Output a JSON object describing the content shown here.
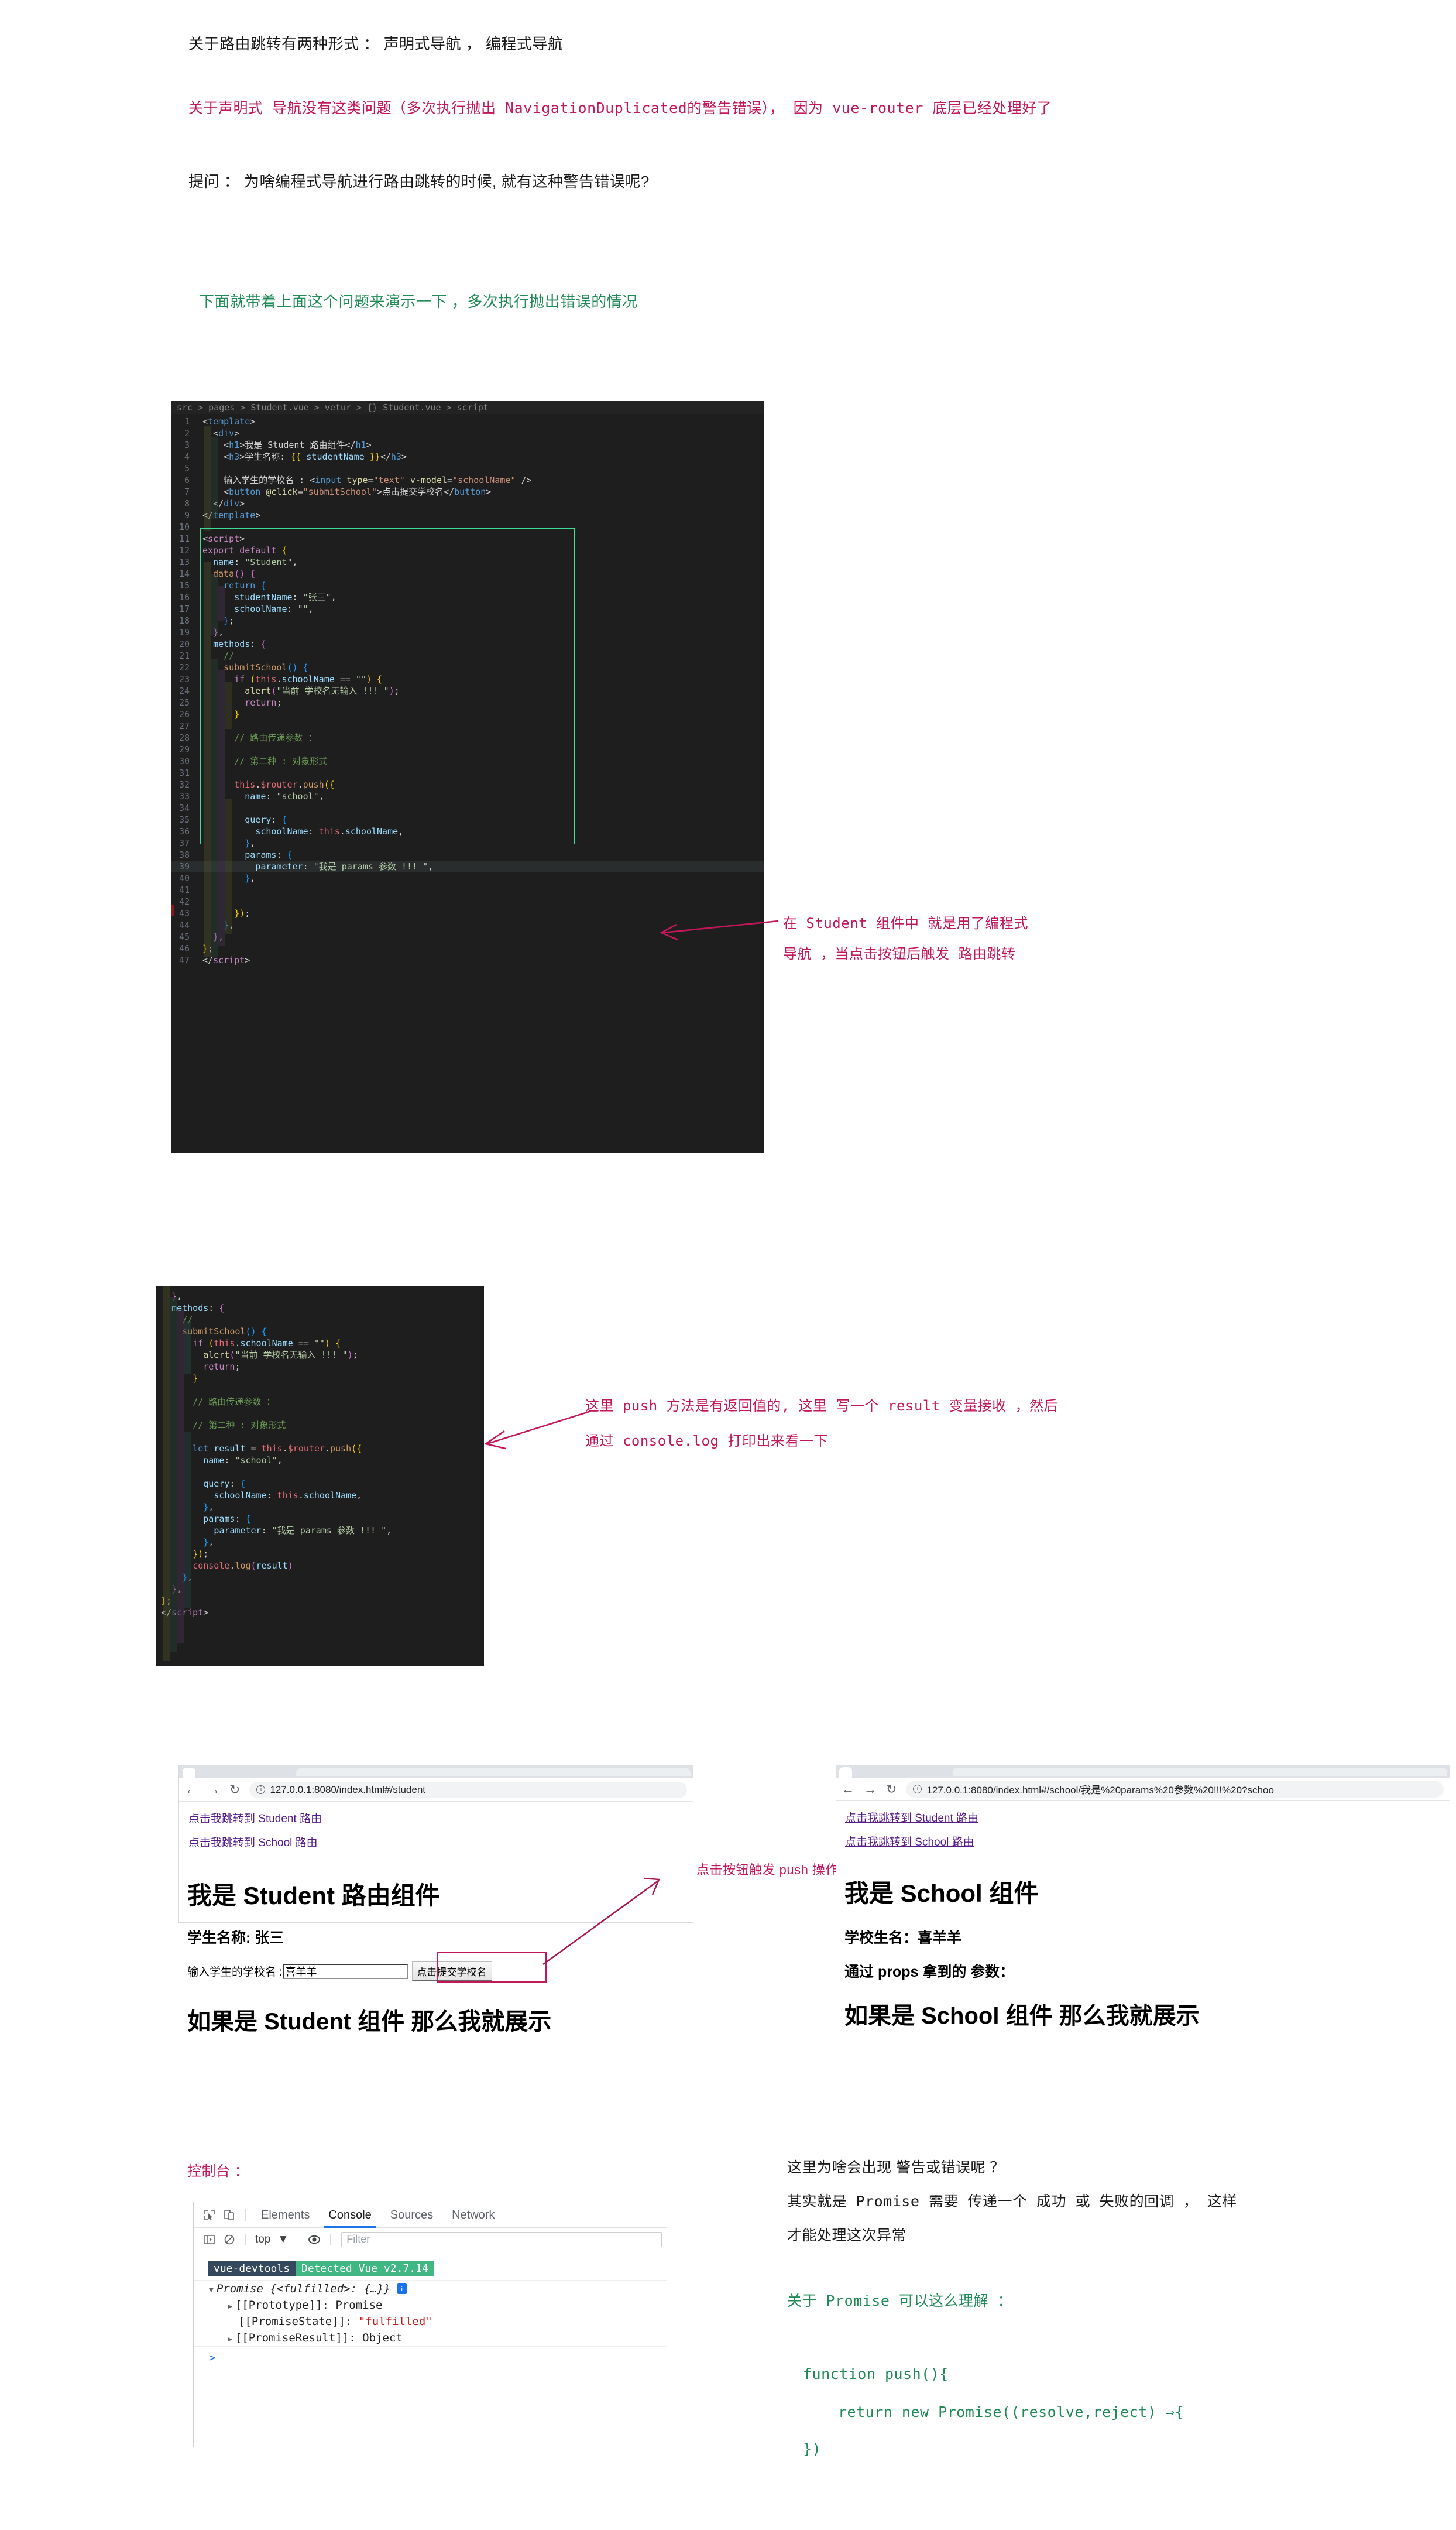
{
  "notes": {
    "intro": "关于路由跳转有两种形式 ：  声明式导航 ，  编程式导航",
    "declarative_red": "关于声明式 导航没有这类问题（多次执行抛出 NavigationDuplicated的警告错误）， 因为 vue-router 底层已经处理好了",
    "question": "提问 ：  为啥编程式导航进行路由跳转的时候, 就有这种警告错误呢?",
    "demo_green": "下面就带着上面这个问题来演示一下 ，多次执行抛出错误的情况",
    "anno1_line1": "在 Student 组件中 就是用了编程式",
    "anno1_line2": "导航 ，当点击按钮后触发 路由跳转",
    "anno2_line1": "这里 push 方法是有返回值的, 这里 写一个 result 变量接收 ，然后",
    "anno2_line2": "通过 console.log 打印出来看一下",
    "anno_button": "点击按钮触发 push 操作",
    "console_label": "控制台 ：",
    "why_warning": "这里为啥会出现 警告或错误呢 ？",
    "promise_explain": "其实就是 Promise 需要 传递一个 成功 或 失败的回调 ， 这样",
    "promise_explain2": "才能处理这次异常",
    "about_promise": "关于 Promise 可以这么理解 ：",
    "promise_code_1": "function push(){",
    "promise_code_2": "return new Promise((resolve,reject) ⇒{",
    "promise_code_3": "})"
  },
  "code1": {
    "breadcrumb": "src > pages > Student.vue > vetur > {} Student.vue > script",
    "lines": [
      {
        "n": "1",
        "html": "<span class='t-punc'>&lt;</span><span class='t-tag'>template</span><span class='t-punc'>&gt;</span>"
      },
      {
        "n": "2",
        "html": "  <span class='t-punc'>&lt;</span><span class='t-tag'>div</span><span class='t-punc'>&gt;</span>"
      },
      {
        "n": "3",
        "html": "    <span class='t-punc'>&lt;</span><span class='t-tag'>h1</span><span class='t-punc'>&gt;</span><span class='t-plain'>我是 Student 路由组件</span><span class='t-punc'>&lt;/</span><span class='t-tag'>h1</span><span class='t-punc'>&gt;</span>"
      },
      {
        "n": "4",
        "html": "    <span class='t-punc'>&lt;</span><span class='t-tag'>h3</span><span class='t-punc'>&gt;</span><span class='t-plain'>学生名称: </span><span class='t-brace1'>{{</span><span class='t-attr'> studentName </span><span class='t-brace1'>}}</span><span class='t-punc'>&lt;/</span><span class='t-tag'>h3</span><span class='t-punc'>&gt;</span>"
      },
      {
        "n": "5",
        "html": ""
      },
      {
        "n": "6",
        "html": "    <span class='t-plain'>输入学生的学校名 : </span><span class='t-punc'>&lt;</span><span class='t-tag'>input</span> <span class='t-fn'>type</span><span class='t-punc'>=</span><span class='t-str'>\"text\"</span> <span class='t-fn'>v-model</span><span class='t-punc'>=</span><span class='t-str'>\"schoolName\"</span> <span class='t-punc'>/&gt;</span>"
      },
      {
        "n": "7",
        "html": "    <span class='t-punc'>&lt;</span><span class='t-tag'>button</span> <span class='t-fn'>@click</span><span class='t-punc'>=</span><span class='t-str'>\"submitSchool\"</span><span class='t-punc'>&gt;</span><span class='t-plain'>点击提交学校名</span><span class='t-punc'>&lt;/</span><span class='t-tag'>button</span><span class='t-punc'>&gt;</span>"
      },
      {
        "n": "8",
        "html": "  <span class='t-punc'>&lt;/</span><span class='t-tag'>div</span><span class='t-punc'>&gt;</span>"
      },
      {
        "n": "9",
        "html": "<span class='t-punc'>&lt;/</span><span class='t-tag'>template</span><span class='t-punc'>&gt;</span>"
      },
      {
        "n": "10",
        "html": ""
      },
      {
        "n": "11",
        "html": "<span class='t-punc'>&lt;</span><span class='t-kw'>script</span><span class='t-punc'>&gt;</span>"
      },
      {
        "n": "12",
        "html": "<span class='t-kw'>export</span> <span class='t-kw'>default</span> <span class='t-brace1'>{</span>"
      },
      {
        "n": "13",
        "html": "  <span class='t-prop'>name</span><span class='t-punc'>:</span> <span class='t-str2'>\"Student\"</span><span class='t-punc'>,</span>"
      },
      {
        "n": "14",
        "html": "  <span class='t-orange'>data</span><span class='t-brace2'>()</span> <span class='t-brace2'>{</span>"
      },
      {
        "n": "15",
        "html": "    <span class='t-kw2'>return</span> <span class='t-brace3'>{</span>"
      },
      {
        "n": "16",
        "html": "      <span class='t-prop'>studentName</span><span class='t-punc'>:</span> <span class='t-str2'>\"张三\"</span><span class='t-punc'>,</span>"
      },
      {
        "n": "17",
        "html": "      <span class='t-prop'>schoolName</span><span class='t-punc'>:</span> <span class='t-str2'>\"\"</span><span class='t-punc'>,</span>"
      },
      {
        "n": "18",
        "html": "    <span class='t-brace3'>}</span><span class='t-punc'>;</span>"
      },
      {
        "n": "19",
        "html": "  <span class='t-brace2'>}</span><span class='t-punc'>,</span>"
      },
      {
        "n": "20",
        "html": "  <span class='t-prop'>methods</span><span class='t-punc'>:</span> <span class='t-brace2'>{</span>"
      },
      {
        "n": "21",
        "html": "    <span class='t-com'>//</span>"
      },
      {
        "n": "22",
        "html": "    <span class='t-orange'>submitSchool</span><span class='t-brace3'>()</span> <span class='t-brace3'>{</span>"
      },
      {
        "n": "23",
        "html": "      <span class='t-kw'>if</span> <span class='t-brace1'>(</span><span class='t-this'>this</span><span class='t-punc'>.</span><span class='t-prop'>schoolName</span> <span class='t-mute'>==</span> <span class='t-str2'>\"\"</span><span class='t-brace1'>)</span> <span class='t-brace1'>{</span>"
      },
      {
        "n": "24",
        "html": "        <span class='t-fn'>alert</span><span class='t-brace2'>(</span><span class='t-str2'>\"当前 学校名无输入 !!! \"</span><span class='t-brace2'>)</span><span class='t-punc'>;</span>"
      },
      {
        "n": "25",
        "html": "        <span class='t-kw'>return</span><span class='t-punc'>;</span>"
      },
      {
        "n": "26",
        "html": "      <span class='t-brace1'>}</span>"
      },
      {
        "n": "27",
        "html": ""
      },
      {
        "n": "28",
        "html": "      <span class='t-com'>// 路由传递参数 ：</span>"
      },
      {
        "n": "29",
        "html": ""
      },
      {
        "n": "30",
        "html": "      <span class='t-com'>// 第二种 : 对象形式</span>"
      },
      {
        "n": "31",
        "html": ""
      },
      {
        "n": "32",
        "html": "      <span class='t-this'>this</span><span class='t-punc'>.</span><span class='t-this'>$router</span><span class='t-punc'>.</span><span class='t-orange'>push</span><span class='t-brace1'>({</span>"
      },
      {
        "n": "33",
        "html": "        <span class='t-prop'>name</span><span class='t-punc'>:</span> <span class='t-str2'>\"school\"</span><span class='t-punc'>,</span>"
      },
      {
        "n": "34",
        "html": ""
      },
      {
        "n": "35",
        "html": "        <span class='t-prop'>query</span><span class='t-punc'>:</span> <span class='t-brace3'>{</span>"
      },
      {
        "n": "36",
        "html": "          <span class='t-prop'>schoolName</span><span class='t-punc'>:</span> <span class='t-this'>this</span><span class='t-punc'>.</span><span class='t-prop'>schoolName</span><span class='t-punc'>,</span>"
      },
      {
        "n": "37",
        "html": "        <span class='t-brace3'>}</span><span class='t-punc'>,</span>"
      },
      {
        "n": "38",
        "html": "        <span class='t-prop'>params</span><span class='t-punc'>:</span> <span class='t-brace3'>{</span>"
      },
      {
        "n": "39",
        "html": "          <span class='t-prop'>parameter</span><span class='t-punc'>:</span> <span class='t-str2'>\"我是 params 参数 !!! \"</span><span class='t-punc'>,</span>"
      },
      {
        "n": "40",
        "html": "        <span class='t-brace3'>}</span><span class='t-punc'>,</span>"
      },
      {
        "n": "41",
        "html": ""
      },
      {
        "n": "42",
        "html": ""
      },
      {
        "n": "43",
        "html": "      <span class='t-brace1'>})</span><span class='t-punc'>;</span>"
      },
      {
        "n": "44",
        "html": "    <span class='t-brace3'>}</span><span class='t-punc'>,</span>"
      },
      {
        "n": "45",
        "html": "  <span class='t-brace2'>}</span><span class='t-punc'>,</span>"
      },
      {
        "n": "46",
        "html": "<span class='t-brace1'>}</span><span class='t-punc'>;</span>"
      },
      {
        "n": "47",
        "html": "<span class='t-punc'>&lt;/</span><span class='t-kw'>script</span><span class='t-punc'>&gt;</span>"
      }
    ]
  },
  "code2": {
    "lines": [
      {
        "html": "  <span class='t-brace2'>}</span><span class='t-punc'>,</span>"
      },
      {
        "html": "  <span class='t-prop'>methods</span><span class='t-punc'>:</span> <span class='t-brace2'>{</span>"
      },
      {
        "html": "    <span class='t-com'>//</span>"
      },
      {
        "html": "    <span class='t-orange'>submitSchool</span><span class='t-brace3'>()</span> <span class='t-brace3'>{</span>"
      },
      {
        "html": "      <span class='t-kw'>if</span> <span class='t-brace1'>(</span><span class='t-this'>this</span><span class='t-punc'>.</span><span class='t-prop'>schoolName</span> <span class='t-mute'>==</span> <span class='t-str2'>\"\"</span><span class='t-brace1'>)</span> <span class='t-brace1'>{</span>"
      },
      {
        "html": "        <span class='t-fn'>alert</span><span class='t-brace2'>(</span><span class='t-str2'>\"当前 学校名无输入 !!! \"</span><span class='t-brace2'>)</span><span class='t-punc'>;</span>"
      },
      {
        "html": "        <span class='t-kw'>return</span><span class='t-punc'>;</span>"
      },
      {
        "html": "      <span class='t-brace1'>}</span>"
      },
      {
        "html": ""
      },
      {
        "html": "      <span class='t-com'>// 路由传递参数 ：</span>"
      },
      {
        "html": ""
      },
      {
        "html": "      <span class='t-com'>// 第二种 : 对象形式</span>"
      },
      {
        "html": ""
      },
      {
        "html": "      <span class='t-kw2'>let</span> <span class='t-attr'>result</span> <span class='t-mute'>=</span> <span class='t-this'>this</span><span class='t-punc'>.</span><span class='t-this'>$router</span><span class='t-punc'>.</span><span class='t-orange'>push</span><span class='t-brace1'>({</span>"
      },
      {
        "html": "        <span class='t-prop'>name</span><span class='t-punc'>:</span> <span class='t-str2'>\"school\"</span><span class='t-punc'>,</span>"
      },
      {
        "html": ""
      },
      {
        "html": "        <span class='t-prop'>query</span><span class='t-punc'>:</span> <span class='t-brace3'>{</span>"
      },
      {
        "html": "          <span class='t-prop'>schoolName</span><span class='t-punc'>:</span> <span class='t-this'>this</span><span class='t-punc'>.</span><span class='t-prop'>schoolName</span><span class='t-punc'>,</span>"
      },
      {
        "html": "        <span class='t-brace3'>}</span><span class='t-punc'>,</span>"
      },
      {
        "html": "        <span class='t-prop'>params</span><span class='t-punc'>:</span> <span class='t-brace3'>{</span>"
      },
      {
        "html": "          <span class='t-prop'>parameter</span><span class='t-punc'>:</span> <span class='t-str2'>\"我是 params 参数 !!! \"</span><span class='t-punc'>,</span>"
      },
      {
        "html": "        <span class='t-brace3'>}</span><span class='t-punc'>,</span>"
      },
      {
        "html": "      <span class='t-brace1'>})</span><span class='t-punc'>;</span>"
      },
      {
        "html": "      <span class='t-this'>console</span><span class='t-punc'>.</span><span class='t-orange'>log</span><span class='t-brace2'>(</span><span class='t-attr'>result</span><span class='t-brace2'>)</span>"
      },
      {
        "html": "    <span class='t-brace3'>}</span><span class='t-punc'>,</span>"
      },
      {
        "html": "  <span class='t-brace2'>}</span><span class='t-punc'>,</span>"
      },
      {
        "html": "<span class='t-brace1'>}</span><span class='t-punc'>;</span>"
      },
      {
        "html": "<span class='t-punc'>&lt;/</span><span class='t-kw'>script</span><span class='t-punc'>&gt;</span>"
      }
    ]
  },
  "browser_student": {
    "url": "127.0.0.1:8080/index.html#/student",
    "link1": "点击我跳转到 Student 路由",
    "link2": "点击我跳转到 School 路由",
    "h1": "我是 Student 路由组件",
    "h3": "学生名称: 张三",
    "input_label": "输入学生的学校名 :",
    "input_value": "喜羊羊",
    "button_label": "点击提交学校名",
    "h1b": "如果是 Student 组件 那么我就展示"
  },
  "browser_school": {
    "url": "127.0.0.1:8080/index.html#/school/我是%20params%20参数%20!!!%20?schoo",
    "link1": "点击我跳转到 Student 路由",
    "link2": "点击我跳转到 School 路由",
    "h1": "我是 School 组件",
    "h3a": "学校生名：喜羊羊",
    "h3b": "通过 props 拿到的 参数：",
    "h1b": "如果是 School 组件 那么我就展示"
  },
  "devtools": {
    "tabs": [
      "Elements",
      "Console",
      "Sources",
      "Network"
    ],
    "active_tab": "Console",
    "context": "top",
    "filter_placeholder": "Filter",
    "badge_left": "vue-devtools",
    "badge_right": "Detected Vue v2.7.14",
    "log_promise": "Promise {<fulfilled>: {…}}",
    "log_prototype": "[[Prototype]]: Promise",
    "log_state_key": "[[PromiseState]]: ",
    "log_state_val": "\"fulfilled\"",
    "log_result": "[[PromiseResult]]: Object",
    "info_glyph": "i"
  },
  "colors": {
    "red": "#c2185b",
    "green": "#1f8a56",
    "accent_blue": "#1a73e8",
    "vue_green": "#41b883",
    "vue_dark": "#35495e"
  }
}
